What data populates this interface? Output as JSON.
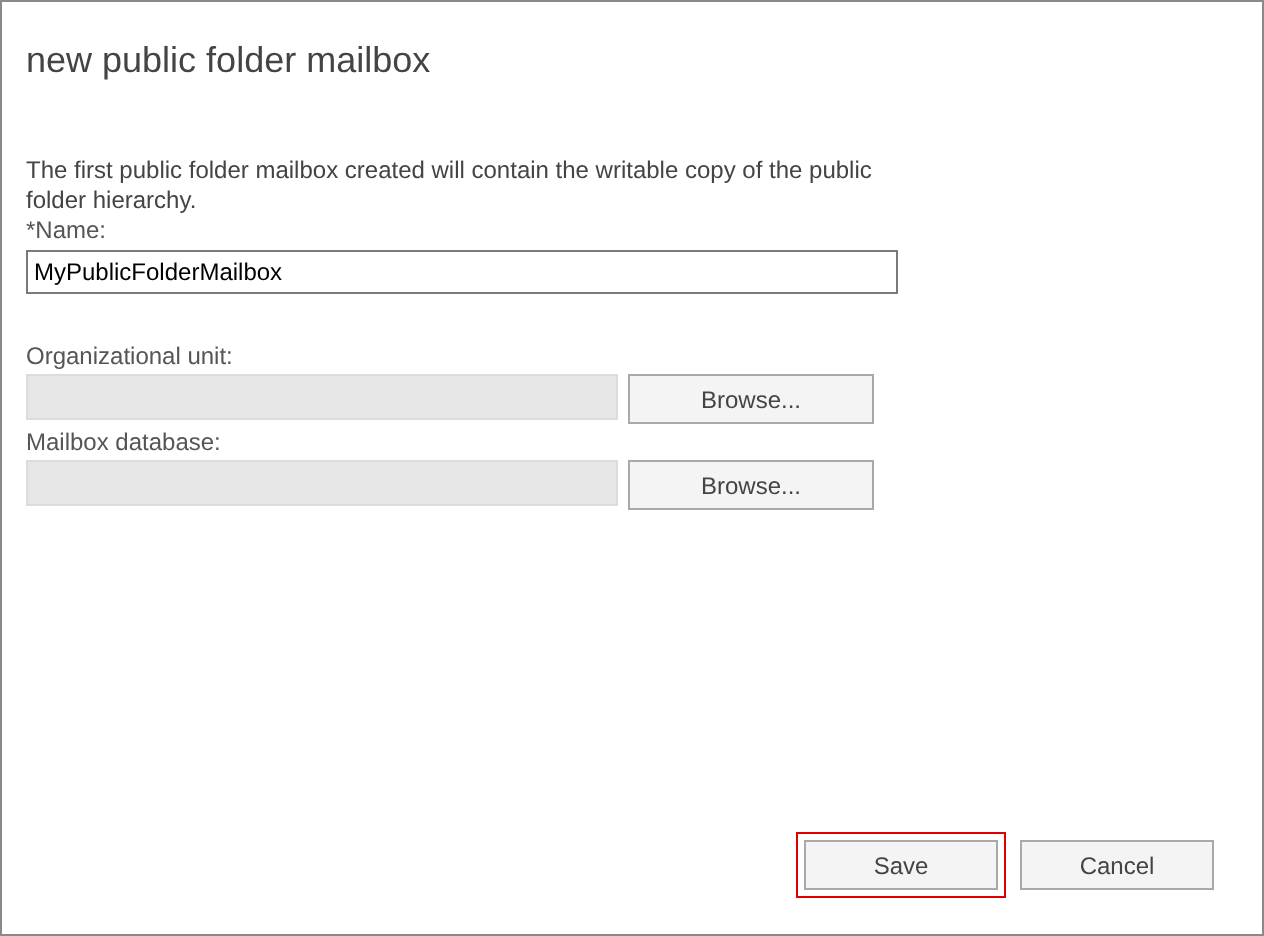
{
  "window": {
    "title": "new public folder mailbox"
  },
  "description": "The first public folder mailbox created will contain the writable copy of the public folder hierarchy.",
  "name_field": {
    "label": "*Name:",
    "value": "MyPublicFolderMailbox"
  },
  "browse_fields": [
    {
      "label": "Organizational unit:",
      "disabled": true,
      "button": "Browse..."
    },
    {
      "label": "Mailbox database:",
      "disabled": true,
      "button": "Browse..."
    }
  ],
  "buttons": [
    {
      "label": "Save",
      "highlighted": true
    },
    {
      "label": "Cancel",
      "highlighted": false
    }
  ]
}
